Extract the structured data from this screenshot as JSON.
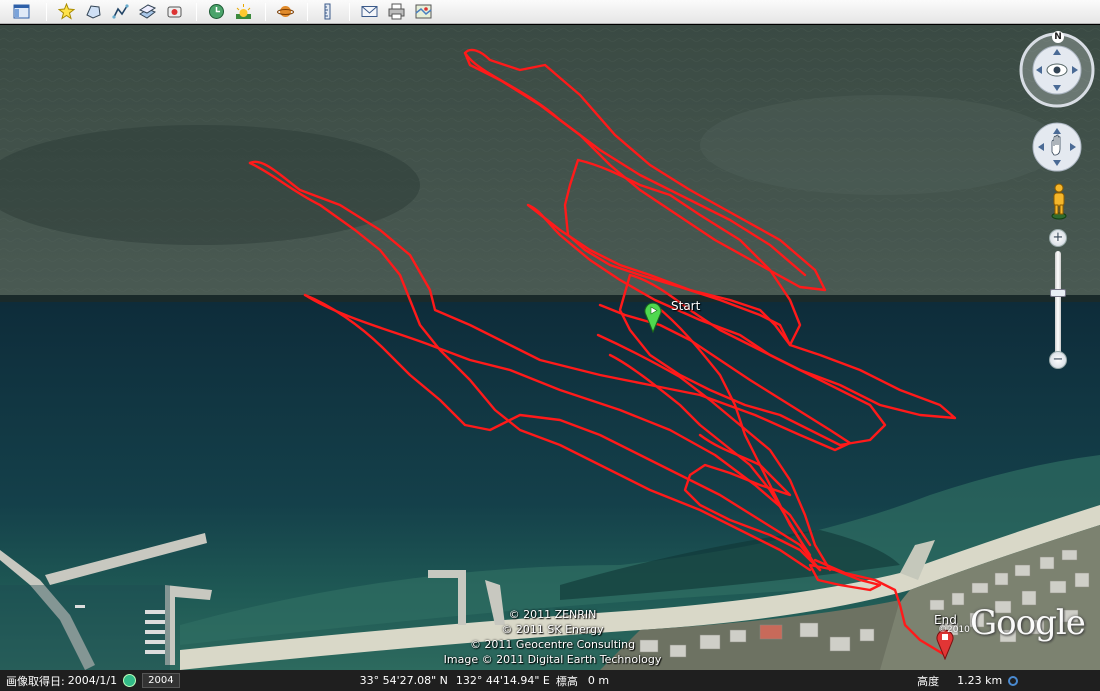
{
  "toolbar": {
    "buttons": [
      {
        "name": "sidebar-toggle-button",
        "icon": "sidebar-icon"
      },
      {
        "name": "add-placemark-button",
        "icon": "pushpin-icon"
      },
      {
        "name": "add-polygon-button",
        "icon": "polygon-icon"
      },
      {
        "name": "add-path-button",
        "icon": "path-icon"
      },
      {
        "name": "add-image-overlay-button",
        "icon": "image-overlay-icon"
      },
      {
        "name": "record-tour-button",
        "icon": "record-tour-icon"
      },
      {
        "name": "historical-imagery-button",
        "icon": "clock-icon"
      },
      {
        "name": "sunlight-button",
        "icon": "sunlight-icon"
      },
      {
        "name": "switch-sky-button",
        "icon": "planet-icon"
      },
      {
        "name": "ruler-button",
        "icon": "ruler-icon"
      },
      {
        "name": "email-button",
        "icon": "email-icon"
      },
      {
        "name": "print-button",
        "icon": "print-icon"
      },
      {
        "name": "view-in-maps-button",
        "icon": "maps-icon"
      }
    ]
  },
  "map": {
    "start_label": "Start",
    "end_label": "End",
    "attribution": [
      "© 2011 ZENRIN",
      "© 2011 SK Energy",
      "© 2011 Geocentre Consulting",
      "Image © 2011 Digital Earth Technology"
    ],
    "logo_text": "Google",
    "logo_year": "©2010",
    "track_color": "#ff1a1a"
  },
  "navigation": {
    "compass_label": "N",
    "zoom_in": "+",
    "zoom_out": "−",
    "zoom_level": 0.35
  },
  "status_bar": {
    "imagery_date_label": "画像取得日:",
    "imagery_date": "2004/1/1",
    "year_badge": "2004",
    "latitude": "33° 54'27.08\" N",
    "longitude": "132° 44'14.94\" E",
    "elevation_label": "標高",
    "elevation": "0 m",
    "eye_alt_label": "高度",
    "eye_alt": "1.23 km"
  }
}
